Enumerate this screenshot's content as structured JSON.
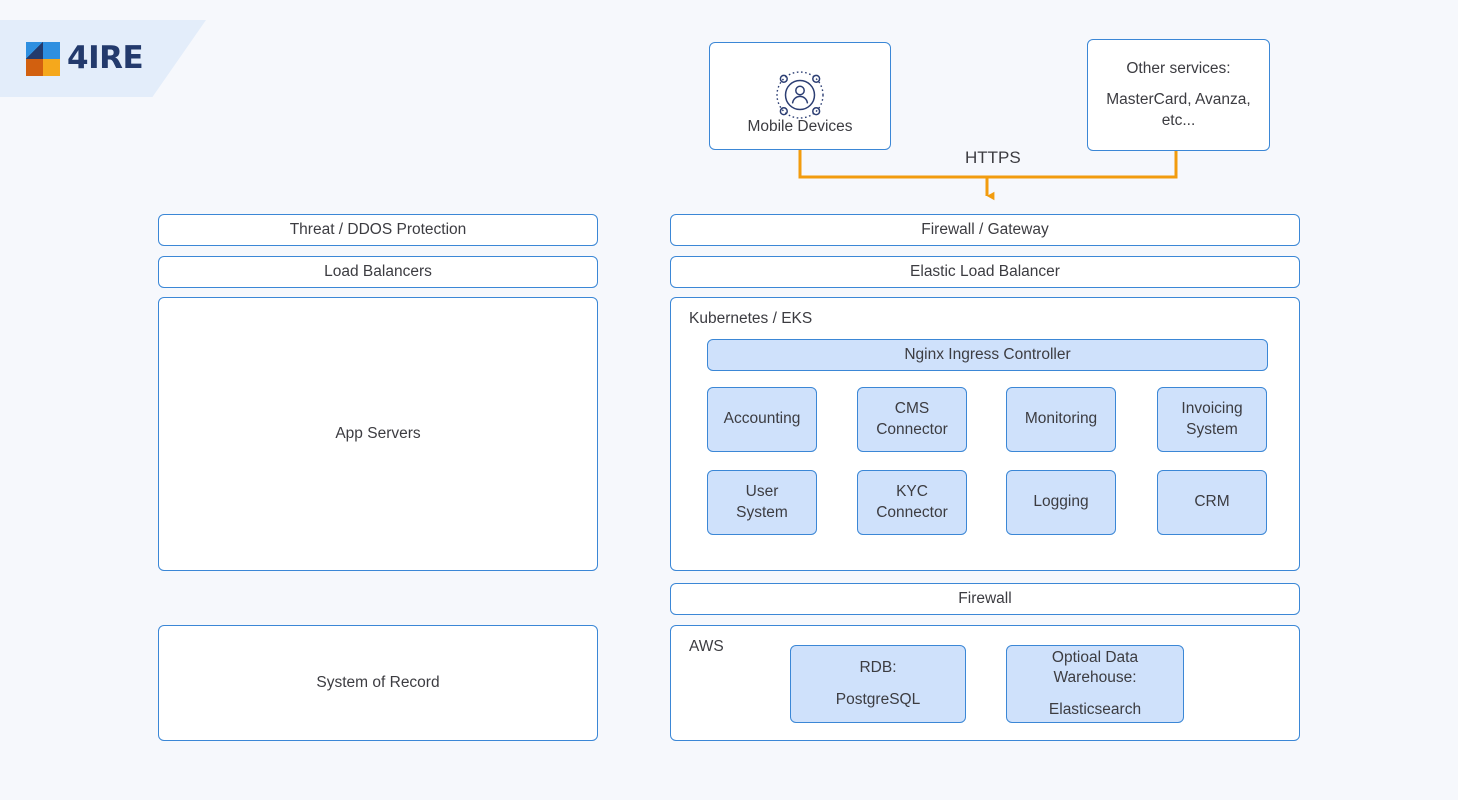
{
  "brand": {
    "logo_text": "4IRE",
    "logo_colors": {
      "navy": "#233a6c",
      "blue": "#2e8fe0",
      "orange": "#d2600f",
      "amber": "#f5a81c"
    },
    "band_color": "#e3edfa"
  },
  "theme": {
    "background": "#f6f8fc",
    "node_border": "#3b87d6",
    "node_fill": "#ffffff",
    "service_fill": "#cfe1fb",
    "connector": "#f29c0e",
    "text": "#3c3c41"
  },
  "diagram": {
    "clients": {
      "mobile_devices": {
        "label": "Mobile Devices",
        "icon": "users-network-icon"
      },
      "other_services": {
        "line1": "Other services:",
        "line2": "MasterCard, Avanza,",
        "line3": "etc..."
      }
    },
    "connector_label": "HTTPS",
    "left_column": [
      {
        "label": "Threat / DDOS Protection"
      },
      {
        "label": "Load Balancers"
      },
      {
        "label": "App Servers"
      },
      {
        "label": "System of Record"
      }
    ],
    "right_column": {
      "firewall_gateway": "Firewall / Gateway",
      "elastic_load_balancer": "Elastic Load Balancer",
      "kubernetes": {
        "title": "Kubernetes / EKS",
        "ingress": "Nginx Ingress Controller",
        "services": [
          {
            "line1": "Accounting",
            "line2": ""
          },
          {
            "line1": "CMS",
            "line2": "Connector"
          },
          {
            "line1": "Monitoring",
            "line2": ""
          },
          {
            "line1": "Invoicing",
            "line2": "System"
          },
          {
            "line1": "User",
            "line2": "System"
          },
          {
            "line1": "KYC",
            "line2": "Connector"
          },
          {
            "line1": "Logging",
            "line2": ""
          },
          {
            "line1": "CRM",
            "line2": ""
          }
        ]
      },
      "firewall": "Firewall",
      "aws": {
        "title": "AWS",
        "stores": [
          {
            "line1": "RDB:",
            "line2": "PostgreSQL"
          },
          {
            "line1": "Optioal Data",
            "line2": "Warehouse:",
            "line3": "Elasticsearch"
          }
        ]
      }
    }
  }
}
